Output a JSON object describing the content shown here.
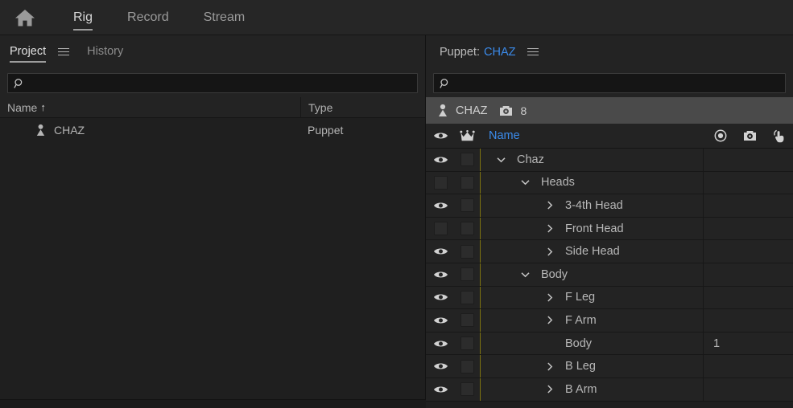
{
  "app": {
    "accent_blue": "#3b8beb",
    "panel_bg": "#232323",
    "divider_yellow": "#7e7310"
  },
  "topnav": {
    "home_icon": "home-icon",
    "tabs": [
      {
        "label": "Rig",
        "active": true
      },
      {
        "label": "Record",
        "active": false
      },
      {
        "label": "Stream",
        "active": false
      }
    ]
  },
  "left_panel": {
    "tabs": [
      {
        "label": "Project",
        "active": true
      },
      {
        "label": "History",
        "active": false
      }
    ],
    "menu_icon": "hamburger-menu-icon",
    "search": {
      "value": "",
      "placeholder": "",
      "icon": "search-icon"
    },
    "columns": [
      {
        "label": "Name",
        "sort": "↑"
      },
      {
        "label": "Type"
      }
    ],
    "rows": [
      {
        "icon": "puppet-icon",
        "name": "CHAZ",
        "type": "Puppet"
      }
    ]
  },
  "right_panel": {
    "title_label": "Puppet:",
    "title_value": "CHAZ",
    "menu_icon": "hamburger-menu-icon",
    "search": {
      "value": "",
      "placeholder": "",
      "icon": "search-icon"
    },
    "breadcrumb": {
      "icon": "puppet-icon",
      "name": "CHAZ",
      "behaviors_icon": "behaviors-icon",
      "behaviors_count": "8"
    },
    "columns": {
      "eye": "visibility-icon",
      "crown": "crown-icon",
      "name": "Name",
      "record": "record-dot-icon",
      "behaviors": "behaviors-icon",
      "triggers": "hand-trigger-icon"
    },
    "rows": [
      {
        "name": "Chaz",
        "indent": 0,
        "twirl": "down",
        "visible": true,
        "record": ""
      },
      {
        "name": "Heads",
        "indent": 1,
        "twirl": "down",
        "visible": false,
        "record": ""
      },
      {
        "name": "3-4th Head",
        "indent": 2,
        "twirl": "right",
        "visible": true,
        "record": ""
      },
      {
        "name": "Front Head",
        "indent": 2,
        "twirl": "right",
        "visible": false,
        "record": ""
      },
      {
        "name": "Side Head",
        "indent": 2,
        "twirl": "right",
        "visible": true,
        "record": ""
      },
      {
        "name": "Body",
        "indent": 1,
        "twirl": "down",
        "visible": true,
        "record": ""
      },
      {
        "name": "F Leg",
        "indent": 2,
        "twirl": "right",
        "visible": true,
        "record": ""
      },
      {
        "name": "F Arm",
        "indent": 2,
        "twirl": "right",
        "visible": true,
        "record": ""
      },
      {
        "name": "Body",
        "indent": 2,
        "twirl": "none",
        "visible": true,
        "record": "1"
      },
      {
        "name": "B Leg",
        "indent": 2,
        "twirl": "right",
        "visible": true,
        "record": ""
      },
      {
        "name": "B Arm",
        "indent": 2,
        "twirl": "right",
        "visible": true,
        "record": ""
      }
    ]
  }
}
